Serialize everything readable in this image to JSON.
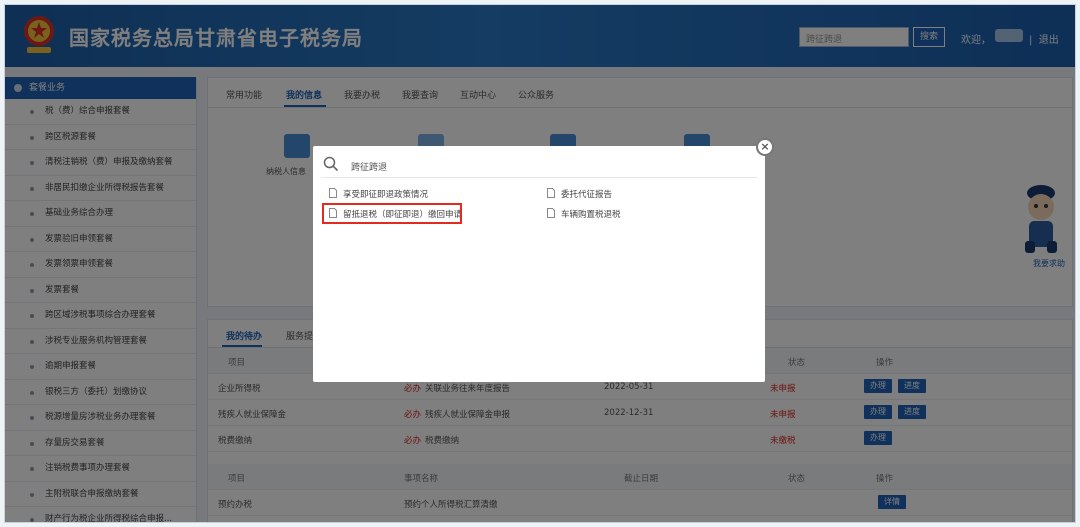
{
  "header": {
    "title": "国家税务总局甘肃省电子税务局",
    "search_placeholder": "跨征跨退",
    "search_button": "搜索",
    "welcome": "欢迎，",
    "separator": "|",
    "logout": "退出",
    "brand_color": "#1e63b6"
  },
  "sidebar": {
    "heading": "套餐业务",
    "items": [
      "税（费）综合申报套餐",
      "跨区税源套餐",
      "清税注销税（费）申报及缴纳套餐",
      "非居民扣缴企业所得税报告套餐",
      "基础业务综合办理",
      "发票验旧申领套餐",
      "发票领票申领套餐",
      "发票套餐",
      "跨区域涉税事项综合办理套餐",
      "涉税专业服务机构管理套餐",
      "逾期申报套餐",
      "银税三方（委托）划缴协议",
      "税源增量房涉税业务办理套餐",
      "存量房交易套餐",
      "注销税费事项办理套餐",
      "主附税联合申报缴纳套餐",
      "财产行为税企业所得税综合申报..."
    ]
  },
  "main": {
    "tabs": [
      "常用功能",
      "我的信息",
      "我要办税",
      "我要查询",
      "互动中心",
      "公众服务"
    ],
    "active_tab": "我的信息",
    "visible_func_label": "纳税人信息"
  },
  "todo": {
    "tabs": [
      "我的待办",
      "服务提醒"
    ],
    "headers": [
      "项目",
      "状态",
      "操作"
    ],
    "rows": [
      {
        "item": "企业所得税",
        "must": "必办",
        "name": "关联业务往来年度报告",
        "date": "2022-05-31",
        "status": "未申报",
        "actions": [
          "办理",
          "进度"
        ]
      },
      {
        "item": "残疾人就业保障金",
        "must": "必办",
        "name": "残疾人就业保障金申报",
        "date": "2022-12-31",
        "status": "未申报",
        "actions": [
          "办理",
          "进度"
        ]
      },
      {
        "item": "税费缴纳",
        "must": "必办",
        "name": "税费缴纳",
        "date": "",
        "status": "未缴税",
        "actions": [
          "办理"
        ]
      }
    ],
    "headers2": [
      "项目",
      "事项名称",
      "截止日期",
      "状态",
      "操作"
    ],
    "rows2": [
      {
        "item": "预约办税",
        "name": "预约个人所得税汇算清缴",
        "date": "",
        "status": "",
        "actions": [
          "详情"
        ]
      }
    ]
  },
  "mascot": {
    "label": "我要求助"
  },
  "modal": {
    "query": "跨征跨退",
    "results": [
      "享受即征即退政策情况",
      "委托代征报告",
      "留抵退税（即征即退）缴回申请",
      "车辆购置税退税"
    ],
    "highlighted_index": 2,
    "close": "×",
    "highlight_color": "#e02b20"
  }
}
